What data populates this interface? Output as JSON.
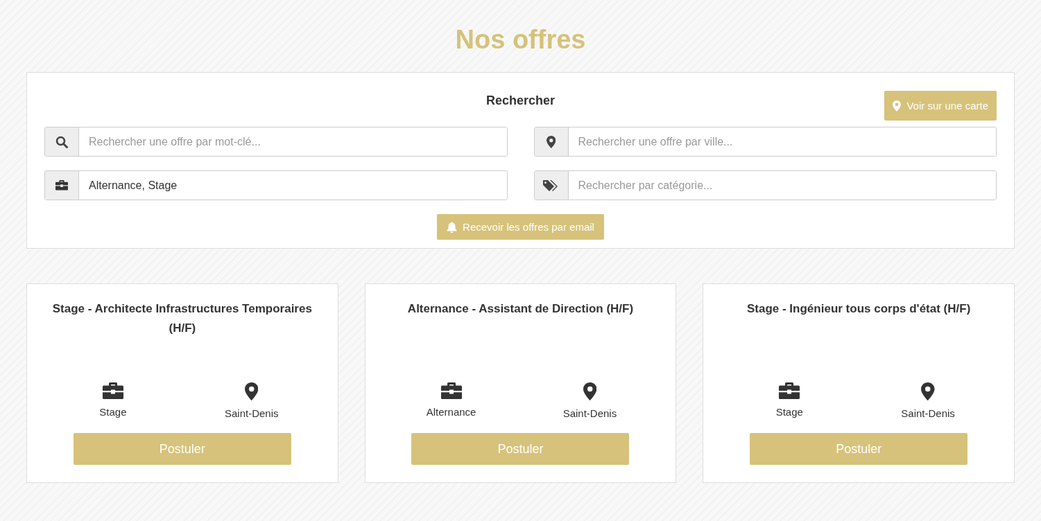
{
  "page_title": "Nos offres",
  "search": {
    "heading": "Rechercher",
    "map_button": "Voir sur une carte",
    "fields": [
      {
        "placeholder": "Rechercher une offre par mot-clé..."
      },
      {
        "placeholder": "Rechercher une offre par ville..."
      },
      {
        "value": "Alternance, Stage"
      },
      {
        "placeholder": "Rechercher par catégorie..."
      }
    ],
    "alert_button": "Recevoir les offres par email"
  },
  "offers": [
    {
      "title": "Stage - Architecte Infrastructures Temporaires (H/F)",
      "contract": "Stage",
      "city": "Saint-Denis",
      "button": "Postuler"
    },
    {
      "title": "Alternance - Assistant de Direction (H/F)",
      "contract": "Alternance",
      "city": "Saint-Denis",
      "button": "Postuler"
    },
    {
      "title": "Stage - Ingénieur tous corps d'état (H/F)",
      "contract": "Stage",
      "city": "Saint-Denis",
      "button": "Postuler"
    }
  ]
}
